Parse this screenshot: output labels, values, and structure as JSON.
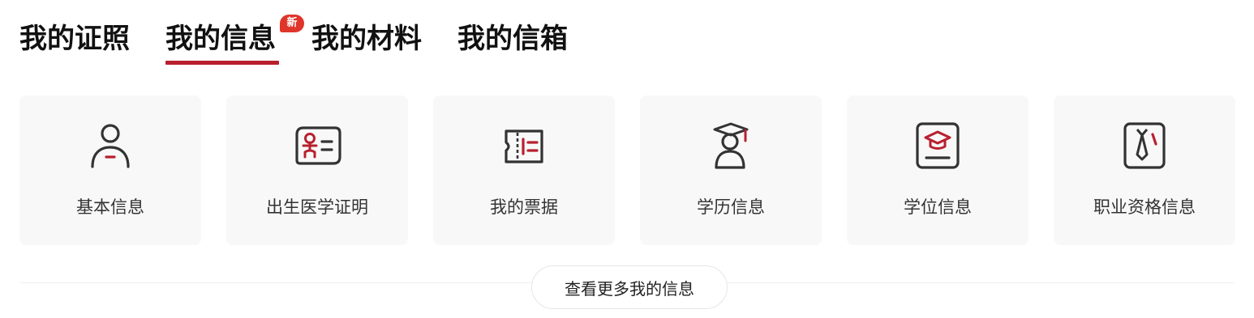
{
  "tabs": [
    {
      "label": "我的证照",
      "active": false
    },
    {
      "label": "我的信息",
      "active": true,
      "badge": "新"
    },
    {
      "label": "我的材料",
      "active": false
    },
    {
      "label": "我的信箱",
      "active": false
    }
  ],
  "cards": [
    {
      "label": "基本信息",
      "icon": "person-icon"
    },
    {
      "label": "出生医学证明",
      "icon": "birth-certificate-icon"
    },
    {
      "label": "我的票据",
      "icon": "ticket-icon"
    },
    {
      "label": "学历信息",
      "icon": "graduate-icon"
    },
    {
      "label": "学位信息",
      "icon": "degree-certificate-icon"
    },
    {
      "label": "职业资格信息",
      "icon": "professional-qualification-icon"
    }
  ],
  "more_button": "查看更多我的信息",
  "colors": {
    "accent": "#b8202e",
    "badge": "#e0352b",
    "icon_stroke": "#333333",
    "card_bg": "#f8f8f8"
  }
}
